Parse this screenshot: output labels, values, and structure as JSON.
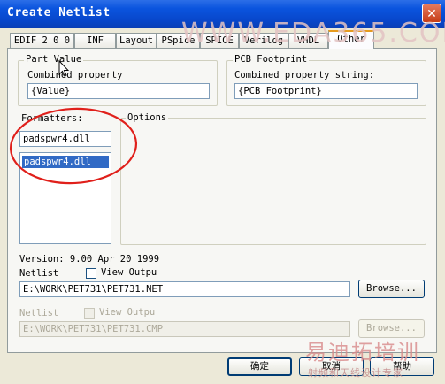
{
  "window": {
    "title": "Create Netlist",
    "close_glyph": "✕"
  },
  "tabs": [
    {
      "label": "EDIF 2 0 0",
      "active": false
    },
    {
      "label": "INF",
      "active": false
    },
    {
      "label": "Layout",
      "active": false
    },
    {
      "label": "PSpice",
      "active": false
    },
    {
      "label": "SPICE",
      "active": false
    },
    {
      "label": "Verilog",
      "active": false
    },
    {
      "label": "VHDL",
      "active": false
    },
    {
      "label": "Other",
      "active": true
    }
  ],
  "part_value": {
    "legend": "Part Value",
    "prop_label": "Combined property",
    "value": "{Value}"
  },
  "pcb_footprint": {
    "legend": "PCB Footprint",
    "prop_label": "Combined property string:",
    "value": "{PCB Footprint}"
  },
  "formatters": {
    "label": "Formatters:",
    "input_value": "padspwr4.dll",
    "items": [
      "padspwr4.dll"
    ]
  },
  "options": {
    "legend": "Options"
  },
  "version": "Version: 9.00  Apr 20 1999",
  "netlist": {
    "label": "Netlist",
    "view_output": "View Outpu",
    "path": "E:\\WORK\\PET731\\PET731.NET",
    "browse": "Browse..."
  },
  "netlist2": {
    "label": "Netlist",
    "view_output": "View Outpu",
    "path": "E:\\WORK\\PET731\\PET731.CMP",
    "browse": "Browse..."
  },
  "buttons": {
    "ok": "确定",
    "cancel": "取消",
    "help": "帮助"
  },
  "watermarks": {
    "top": "WWW.EDA365.COM",
    "bottom": "易迪拓培训",
    "bottom_sub": "射频和天线设计专家"
  },
  "annotation_color": "#e0201b"
}
